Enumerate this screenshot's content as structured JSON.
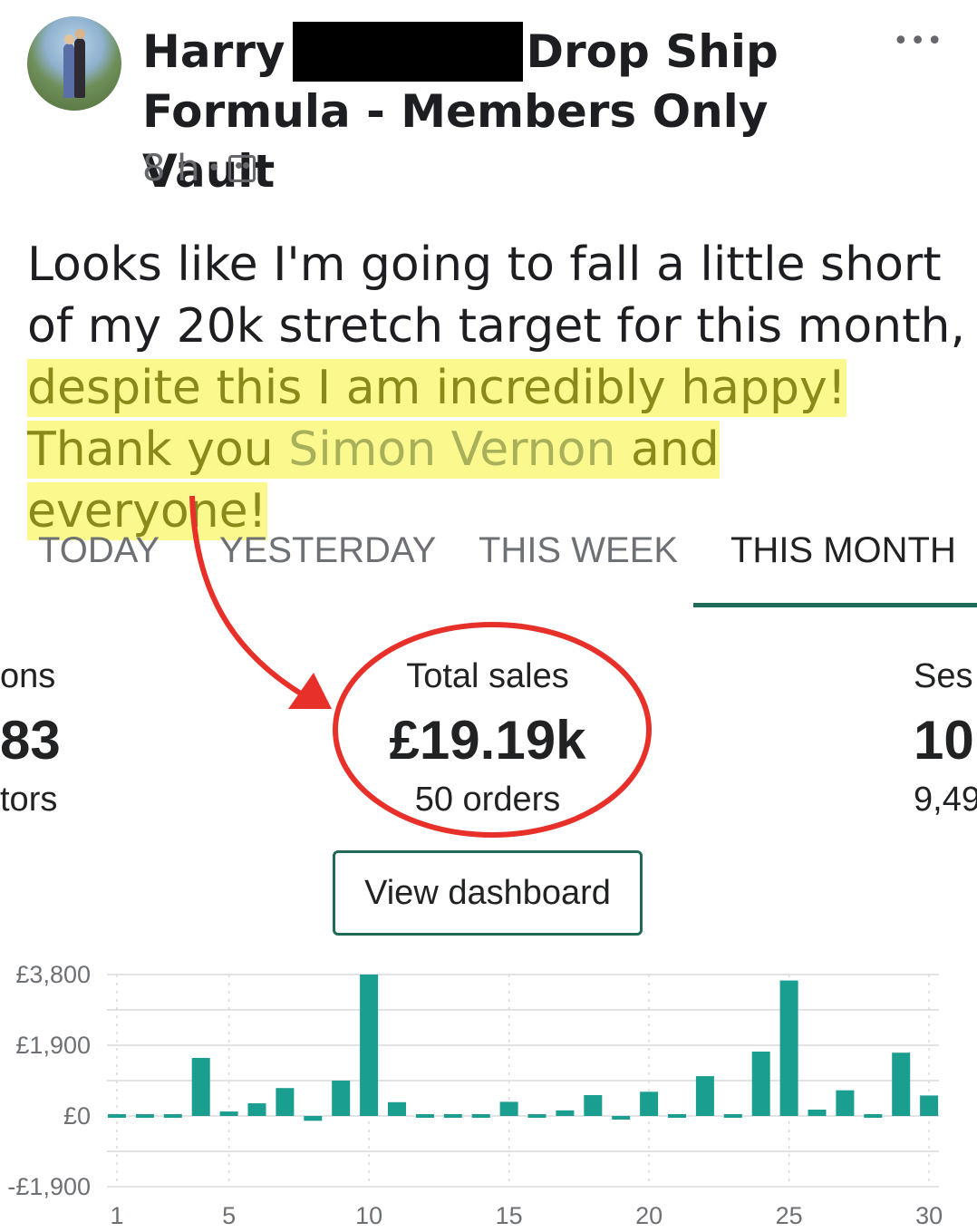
{
  "post": {
    "author": "Harry",
    "group": "Drop Ship",
    "group_line2": "Formula - Members Only Vault",
    "time": "8 h",
    "text_plain": "Looks like I'm going to fall a little short of my 20k stretch target for this month,",
    "text_highlight_1": "despite this I am incredibly happy! Thank you",
    "mention": "Simon Vernon",
    "text_highlight_2": "and everyone!"
  },
  "dashboard": {
    "tabs": [
      "TODAY",
      "YESTERDAY",
      "THIS WEEK",
      "THIS MONTH"
    ],
    "active_tab": "THIS MONTH",
    "left_stat": {
      "label": "ons",
      "value": "83",
      "sub": "tors"
    },
    "center_stat": {
      "label": "Total sales",
      "value": "£19.19k",
      "sub": "50 orders"
    },
    "right_stat": {
      "label": "Ses",
      "value": "10",
      "sub": "9,49"
    },
    "button": "View dashboard"
  },
  "colors": {
    "accent": "#1f6b57",
    "bar": "#1a9e8f",
    "annotation": "#e8302a",
    "highlight": "#fbf98e"
  },
  "chart_data": {
    "type": "bar",
    "x": [
      1,
      2,
      3,
      4,
      5,
      6,
      7,
      8,
      9,
      10,
      11,
      12,
      13,
      14,
      15,
      16,
      17,
      18,
      19,
      20,
      21,
      22,
      23,
      24,
      25,
      26,
      27,
      28,
      29,
      30
    ],
    "values": [
      0,
      0,
      0,
      1560,
      120,
      340,
      750,
      -130,
      950,
      3800,
      370,
      0,
      0,
      0,
      380,
      0,
      150,
      560,
      -80,
      650,
      0,
      1070,
      0,
      1730,
      3640,
      170,
      690,
      0,
      1700,
      550
    ],
    "ylim": [
      -1900,
      3800
    ],
    "yticks": [
      "£3,800",
      "£1,900",
      "£0",
      "-£1,900"
    ],
    "ytick_values": [
      3800,
      1900,
      0,
      -1900
    ],
    "xticks": [
      1,
      5,
      10,
      15,
      20,
      25,
      30
    ],
    "grid": true
  }
}
